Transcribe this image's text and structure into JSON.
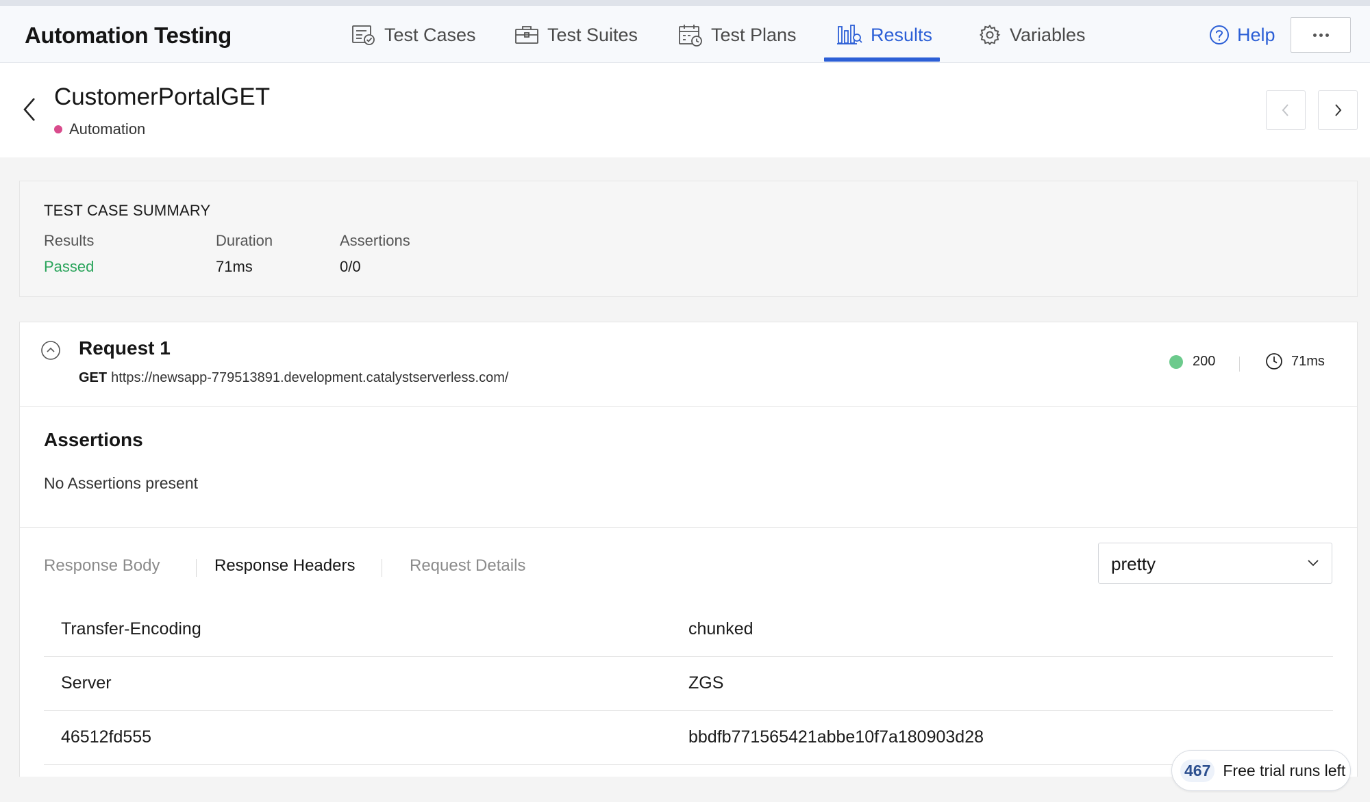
{
  "app": {
    "title": "Automation Testing"
  },
  "nav": {
    "items": [
      {
        "label": "Test Cases",
        "icon": "test-cases-icon"
      },
      {
        "label": "Test Suites",
        "icon": "test-suites-icon"
      },
      {
        "label": "Test Plans",
        "icon": "test-plans-icon"
      },
      {
        "label": "Results",
        "icon": "results-icon",
        "active": true
      },
      {
        "label": "Variables",
        "icon": "gear-icon"
      }
    ],
    "help_label": "Help",
    "accent_color": "#2c5fd6"
  },
  "header": {
    "title": "CustomerPortalGET",
    "tag": "Automation",
    "tag_color": "#d94b8c"
  },
  "summary": {
    "title": "TEST CASE SUMMARY",
    "results_label": "Results",
    "results_value": "Passed",
    "duration_label": "Duration",
    "duration_value": "71ms",
    "assertions_label": "Assertions",
    "assertions_value": "0/0"
  },
  "request": {
    "title": "Request 1",
    "method": "GET",
    "url": "https://newsapp-779513891.development.catalystserverless.com/",
    "status_code": "200",
    "time": "71ms"
  },
  "assertions": {
    "title": "Assertions",
    "empty_text": "No Assertions present"
  },
  "response_tabs": {
    "items": [
      "Response Body",
      "Response Headers",
      "Request Details"
    ],
    "active_index": 1,
    "format_selected": "pretty"
  },
  "headers_table": {
    "rows": [
      {
        "key": "Transfer-Encoding",
        "value": "chunked"
      },
      {
        "key": "Server",
        "value": "ZGS"
      },
      {
        "key": "46512fd555",
        "value": "bbdfb771565421abbe10f7a180903d28"
      }
    ]
  },
  "trial": {
    "count": "467",
    "label": "Free trial runs left"
  }
}
